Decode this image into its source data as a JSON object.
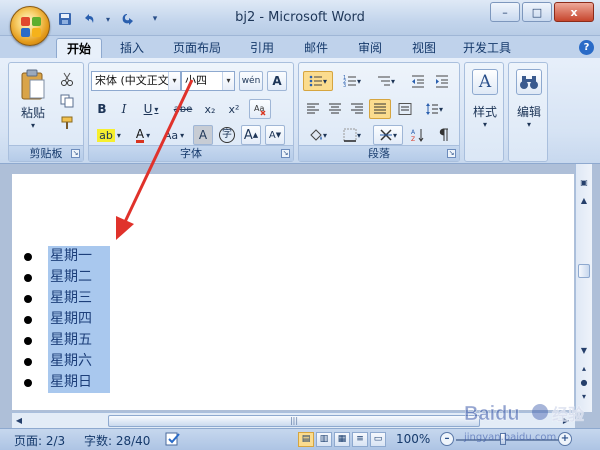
{
  "window": {
    "title": "bj2 - Microsoft Word",
    "minimize": "–",
    "maximize": "□",
    "close": "x"
  },
  "qat": {
    "save_icon": "save-icon",
    "undo_icon": "undo-icon",
    "redo_icon": "redo-icon"
  },
  "tabs": [
    {
      "label": "开始",
      "active": true
    },
    {
      "label": "插入"
    },
    {
      "label": "页面布局"
    },
    {
      "label": "引用"
    },
    {
      "label": "邮件"
    },
    {
      "label": "审阅"
    },
    {
      "label": "视图"
    },
    {
      "label": "开发工具"
    }
  ],
  "ribbon": {
    "clipboard": {
      "label": "剪贴板",
      "paste": "粘贴"
    },
    "font": {
      "label": "字体",
      "font_name": "宋体 (中文正文",
      "font_size": "小四",
      "wen_glyph": "wén",
      "a_glyph": "A",
      "bold": "B",
      "italic": "I",
      "underline": "U",
      "strike": "abe",
      "subscript": "x₂",
      "superscript": "x²",
      "highlight": "ab",
      "font_color": "A",
      "change_case": "Aa",
      "char_shade": "A",
      "enclose": "字",
      "grow": "A",
      "shrink": "A"
    },
    "paragraph": {
      "label": "段落"
    },
    "styles": {
      "label": "样式"
    },
    "editing": {
      "label": "编辑"
    }
  },
  "document": {
    "list_items": [
      "星期一",
      "星期二",
      "星期三",
      "星期四",
      "星期五",
      "星期六",
      "星期日"
    ]
  },
  "status": {
    "page": "页面: 2/3",
    "words": "字数: 28/40",
    "zoom": "100%"
  },
  "watermark": {
    "brand": "Baidu",
    "brand_suffix": "经验",
    "url": "jingyan.baidu.com"
  },
  "colors": {
    "accent": "#2a6bc7",
    "selection": "#a9c8ee",
    "annotation_arrow": "#e0322b"
  }
}
